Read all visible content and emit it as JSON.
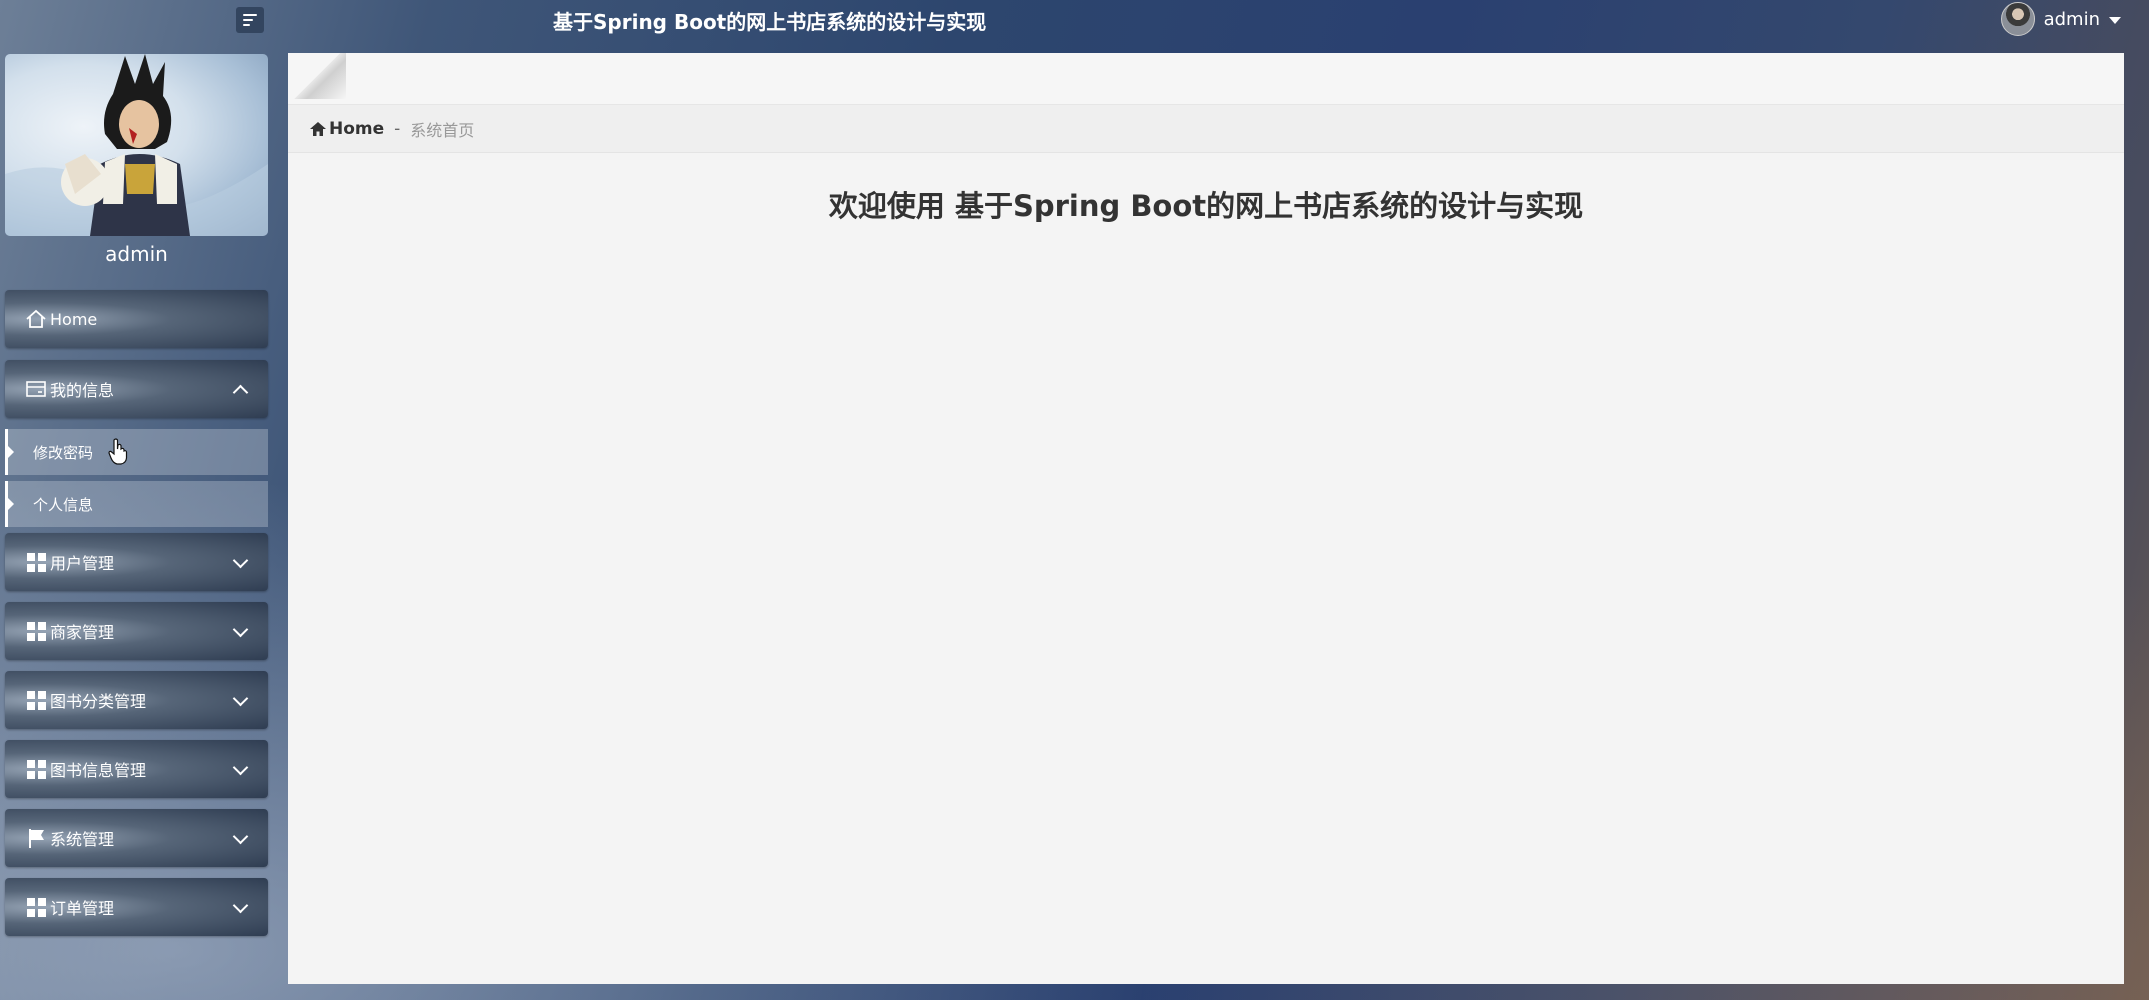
{
  "header": {
    "title": "基于Spring Boot的网上书店系统的设计与实现",
    "user_name": "admin"
  },
  "sidebar": {
    "profile_name": "admin",
    "items": [
      {
        "label": "Home",
        "icon": "home-icon"
      },
      {
        "label": "我的信息",
        "icon": "card-icon",
        "expanded": true,
        "children": [
          {
            "label": "修改密码"
          },
          {
            "label": "个人信息"
          }
        ]
      },
      {
        "label": "用户管理",
        "icon": "grid-icon"
      },
      {
        "label": "商家管理",
        "icon": "grid-icon"
      },
      {
        "label": "图书分类管理",
        "icon": "grid-icon"
      },
      {
        "label": "图书信息管理",
        "icon": "grid-icon"
      },
      {
        "label": "系统管理",
        "icon": "flag-icon"
      },
      {
        "label": "订单管理",
        "icon": "grid-icon"
      }
    ]
  },
  "breadcrumb": {
    "home": "Home",
    "separator": "-",
    "current": "系统首页"
  },
  "main": {
    "welcome": "欢迎使用 基于Spring Boot的网上书店系统的设计与实现"
  },
  "colors": {
    "panel_bg": "#f4f4f4",
    "header_text": "#ffffff",
    "nav_dark": "#2f3d52"
  }
}
